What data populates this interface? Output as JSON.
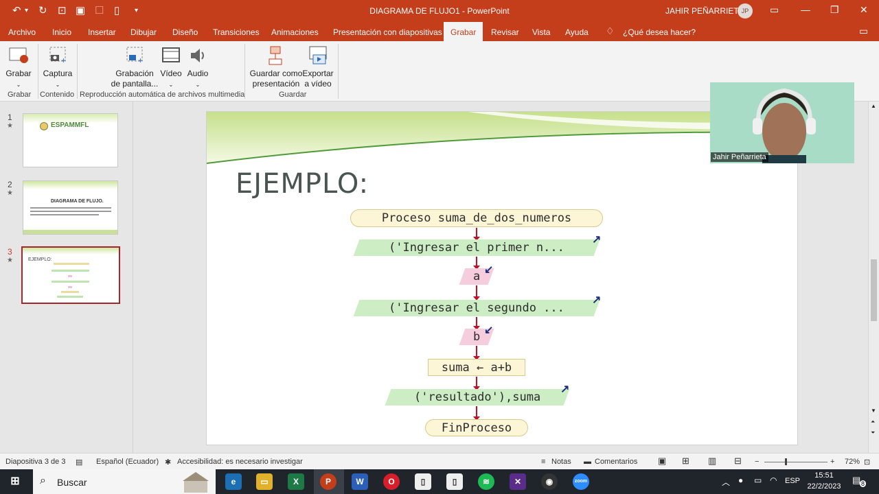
{
  "titlebar": {
    "document_title": "DIAGRAMA DE FLUJO1  -  PowerPoint",
    "user_name": "JAHIR PEÑARRIETA",
    "avatar_initials": "JP"
  },
  "menu_tabs": [
    "Archivo",
    "Inicio",
    "Insertar",
    "Dibujar",
    "Diseño",
    "Transiciones",
    "Animaciones",
    "Presentación con diapositivas",
    "Grabar",
    "Revisar",
    "Vista",
    "Ayuda"
  ],
  "active_tab": "Grabar",
  "tell_me": "¿Qué desea hacer?",
  "ribbon": {
    "buttons": {
      "grabar": "Grabar",
      "captura": "Captura",
      "grabacion_l1": "Grabación",
      "grabacion_l2": "de pantalla...",
      "video": "Vídeo",
      "audio": "Audio",
      "guardar_l1": "Guardar como",
      "guardar_l2": "presentación",
      "exportar_l1": "Exportar",
      "exportar_l2": "a vídeo"
    },
    "groups": {
      "grabar": "Grabar",
      "contenido": "Contenido",
      "reproduccion": "Reproducción automática de archivos multimedia",
      "guardar": "Guardar"
    }
  },
  "thumbnails": [
    {
      "number": "1",
      "title": "ESPAMMFL"
    },
    {
      "number": "2",
      "title": "DIAGRAMA DE FLUJO."
    },
    {
      "number": "3",
      "title": "EJEMPLO:"
    }
  ],
  "slide": {
    "title": "EJEMPLO:",
    "flowchart": {
      "start": "Proceso suma_de_dos_numeros",
      "print1": "('Ingresar el primer n...",
      "read1": "a",
      "print2": "('Ingresar el segundo ...",
      "read2": "b",
      "assign": "suma ← a+b",
      "print3": "('resultado'),suma",
      "end": "FinProceso"
    }
  },
  "webcam": {
    "name": "Jahir Peñarrieta"
  },
  "statusbar": {
    "slide_info": "Diapositiva 3 de 3",
    "language": "Español (Ecuador)",
    "accessibility": "Accesibilidad: es necesario investigar",
    "notes": "Notas",
    "comments": "Comentarios",
    "zoom": "72%"
  },
  "taskbar": {
    "search": "Buscar",
    "lang": "ESP",
    "time": "15:51",
    "date": "22/2/2023",
    "notifications": "8"
  },
  "colors": {
    "accent": "#c43e1c",
    "io_fill": "#cdeec4",
    "input_fill": "#f6cddd",
    "terminal_fill": "#fcf5d6",
    "arrow": "#c0102a"
  }
}
